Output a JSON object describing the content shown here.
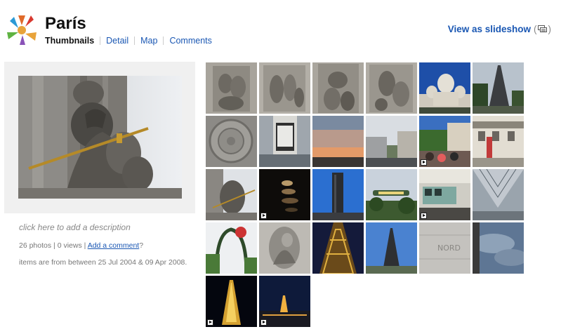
{
  "album": {
    "title": "París",
    "tabs": [
      "Thumbnails",
      "Detail",
      "Map",
      "Comments"
    ],
    "active_tab": "Thumbnails",
    "slideshow_label": "View as slideshow",
    "description_prompt": "click here to add a description",
    "stats": {
      "photos": "26 photos",
      "views": "0 views",
      "comment_link": "Add a comment",
      "comment_suffix": "?"
    },
    "date_range": "items are from between 25 Jul 2004 & 09 Apr 2008."
  },
  "thumbnails": [
    {
      "name": "relief-sculpture-1",
      "video": false
    },
    {
      "name": "relief-sculpture-2",
      "video": false
    },
    {
      "name": "relief-sculpture-3",
      "video": false
    },
    {
      "name": "relief-sculpture-4",
      "video": false
    },
    {
      "name": "sacre-coeur",
      "video": false
    },
    {
      "name": "eiffel-tower-trees",
      "video": false
    },
    {
      "name": "manhole-cover",
      "video": false
    },
    {
      "name": "poster-column",
      "video": false
    },
    {
      "name": "sunset-sky",
      "video": false
    },
    {
      "name": "street-view",
      "video": false
    },
    {
      "name": "crowd-street",
      "video": true
    },
    {
      "name": "building-banners",
      "video": false
    },
    {
      "name": "statue-sword",
      "video": false
    },
    {
      "name": "dark-lights",
      "video": true
    },
    {
      "name": "montparnasse-tower",
      "video": false
    },
    {
      "name": "metro-sign",
      "video": false
    },
    {
      "name": "metro-train",
      "video": true
    },
    {
      "name": "louvre-pyramid-inverted",
      "video": false
    },
    {
      "name": "metro-entrance",
      "video": false
    },
    {
      "name": "stone-carving",
      "video": false
    },
    {
      "name": "eiffel-structure-night",
      "video": false
    },
    {
      "name": "eiffel-tower-day",
      "video": false
    },
    {
      "name": "stone-wall-letters",
      "video": false
    },
    {
      "name": "cloudy-sky",
      "video": false
    },
    {
      "name": "eiffel-tower-night",
      "video": true
    },
    {
      "name": "paris-night-skyline",
      "video": true
    }
  ]
}
